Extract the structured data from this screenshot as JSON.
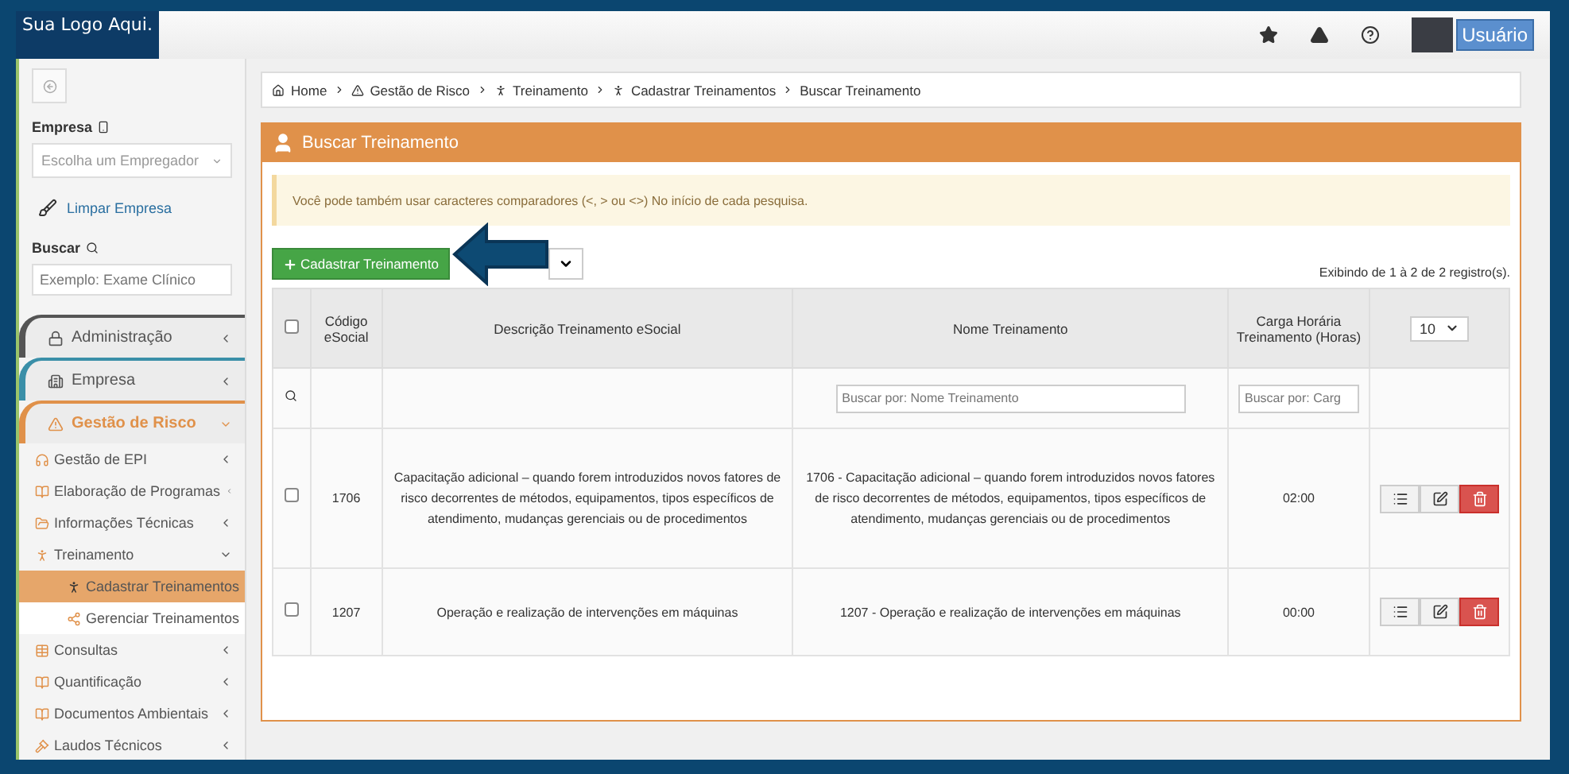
{
  "logo": "Sua Logo Aqui.",
  "topbar": {
    "user_button": "Usuário"
  },
  "sidebar": {
    "company_label": "Empresa",
    "company_select": {
      "placeholder": "Escolha um Empregador"
    },
    "clear_link": "Limpar Empresa",
    "search_label": "Buscar",
    "search_field": {
      "placeholder": "Exemplo: Exame Clínico"
    },
    "menu": [
      {
        "label": "Administração",
        "color": "#555555",
        "expanded": false
      },
      {
        "label": "Empresa",
        "color": "#3a8fa8",
        "expanded": false
      },
      {
        "label": "Gestão de Risco",
        "color": "#e0914a",
        "expanded": true,
        "children": [
          {
            "label": "Gestão de EPI",
            "expanded": false,
            "selected": false
          },
          {
            "label": "Elaboração de Programas",
            "expanded": false,
            "selected": false
          },
          {
            "label": "Informações Técnicas",
            "expanded": false,
            "selected": false
          },
          {
            "label": "Treinamento",
            "expanded": true,
            "selected": false,
            "children": [
              {
                "label": "Cadastrar Treinamentos",
                "selected": true
              },
              {
                "label": "Gerenciar Treinamentos",
                "selected": false
              }
            ]
          },
          {
            "label": "Consultas",
            "expanded": false,
            "selected": false
          },
          {
            "label": "Quantificação",
            "expanded": false,
            "selected": false
          },
          {
            "label": "Documentos Ambientais",
            "expanded": false,
            "selected": false
          },
          {
            "label": "Laudos Técnicos",
            "expanded": false,
            "selected": false
          }
        ]
      }
    ]
  },
  "breadcrumb": [
    "Home",
    "Gestão de Risco",
    "Treinamento",
    "Cadastrar Treinamentos",
    "Buscar Treinamento"
  ],
  "panel": {
    "title": "Buscar Treinamento",
    "alert": "Você pode também usar caracteres comparadores (<, > ou <>) No início de cada pesquisa.",
    "add_button": "Cadastrar Treinamento",
    "record_count": "Exibindo de 1 à 2 de 2 registro(s).",
    "page_size": "10"
  },
  "table": {
    "select_all": false,
    "columns": [
      "Código eSocial",
      "Descrição Treinamento eSocial",
      "Nome Treinamento",
      "Carga Horária Treinamento (Horas)"
    ],
    "filters": {
      "name_placeholder": "Buscar por: Nome Treinamento",
      "hours_placeholder": "Buscar por: Carg"
    },
    "rows": [
      {
        "checked": false,
        "code": "1706",
        "description": "Capacitação adicional – quando forem introduzidos novos fatores de risco decorrentes de métodos, equipamentos, tipos específicos de atendimento, mudanças gerenciais ou de procedimentos",
        "name": "1706 - Capacitação adicional – quando forem introduzidos novos fatores de risco decorrentes de métodos, equipamentos, tipos específicos de atendimento, mudanças gerenciais ou de procedimentos",
        "hours": "02:00"
      },
      {
        "checked": false,
        "code": "1207",
        "description": "Operação e realização de intervenções em máquinas",
        "name": "1207 - Operação e realização de intervenções em máquinas",
        "hours": "00:00"
      }
    ]
  }
}
